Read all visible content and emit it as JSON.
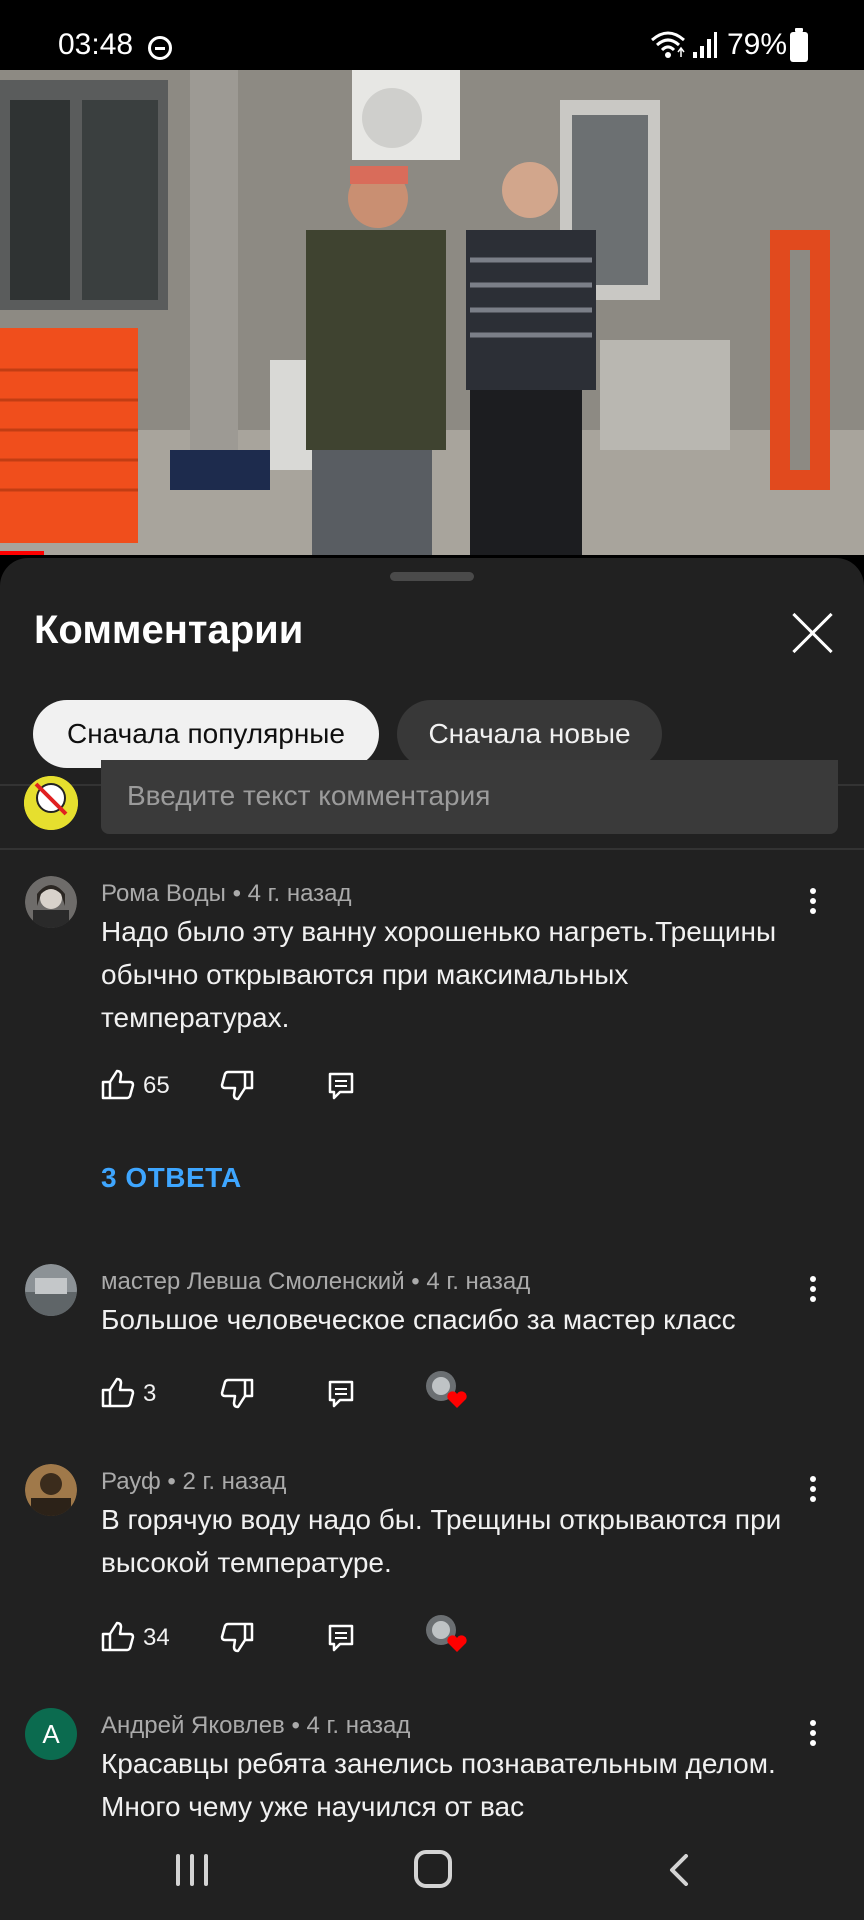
{
  "status_bar": {
    "time": "03:48",
    "battery": "79%"
  },
  "comments_panel": {
    "title": "Комментарии",
    "sort_options": [
      "Сначала популярные",
      "Сначала новые"
    ],
    "input_placeholder": "Введите текст комментария"
  },
  "comments": [
    {
      "author": "Рома Воды",
      "time": "4 г. назад",
      "meta": "Рома Воды • 4 г. назад",
      "text": "Надо было эту ванну хорошенько нагреть.Трещины обычно открываются при максимальных температурах.",
      "likes": "65",
      "replies": "3 ОТВЕТА"
    },
    {
      "author": "мастер Левша Смоленский",
      "time": "4 г. назад",
      "meta": "мастер Левша Смоленский • 4 г. назад",
      "text": "Большое человеческое спасибо за мастер класс",
      "likes": "3",
      "hearted": true
    },
    {
      "author": "Рауф",
      "time": "2 г. назад",
      "meta": "Рауф • 2 г. назад",
      "text": "В горячую воду надо бы. Трещины открываются при высокой температуре.",
      "likes": "34",
      "hearted": true
    },
    {
      "author": "Андрей Яковлев",
      "time": "4 г. назад",
      "meta": "Андрей Яковлев • 4 г. назад",
      "avatar_letter": "А",
      "text": "Красавцы ребята занелись познавательным делом. Много чему уже научился от вас"
    }
  ],
  "colors": {
    "panel_bg": "#212121",
    "link_blue": "#3ea6ff",
    "heart_red": "#ff0000",
    "avatar_green": "#0b6b4f"
  },
  "icons": [
    "dnd-icon",
    "wifi-icon",
    "signal-icon",
    "battery-icon",
    "close-icon",
    "like-icon",
    "dislike-icon",
    "reply-icon",
    "more-icon",
    "heart-icon",
    "recents-icon",
    "home-icon",
    "back-icon"
  ]
}
